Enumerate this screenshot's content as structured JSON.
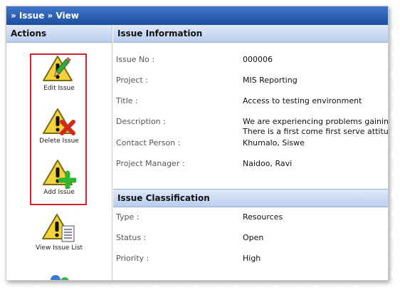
{
  "titlebar": {
    "text": "» Issue » View"
  },
  "actions_panel": {
    "header": "Actions",
    "items": [
      {
        "label": "Edit Issue",
        "icon": "edit-issue-icon"
      },
      {
        "label": "Delete Issue",
        "icon": "delete-issue-icon"
      },
      {
        "label": "Add Issue",
        "icon": "add-issue-icon"
      },
      {
        "label": "View Issue List",
        "icon": "view-issue-list-icon"
      },
      {
        "label": "",
        "icon": "users-icon"
      }
    ]
  },
  "issue_information": {
    "header": "Issue Information",
    "fields": [
      {
        "label": "Issue No :",
        "value": "000006"
      },
      {
        "label": "Project :",
        "value": "MIS Reporting"
      },
      {
        "label": "Title :",
        "value": "Access to testing environment"
      },
      {
        "label": "Description :",
        "value": "We are experiencing problems gaining ac",
        "value2": "There is a first come first serve attitude."
      },
      {
        "label": "Contact Person :",
        "value": "Khumalo, Siswe"
      },
      {
        "label": "Project Manager :",
        "value": "Naidoo, Ravi"
      }
    ]
  },
  "issue_classification": {
    "header": "Issue Classification",
    "fields": [
      {
        "label": "Type :",
        "value": "Resources"
      },
      {
        "label": "Status :",
        "value": "Open"
      },
      {
        "label": "Priority :",
        "value": "High"
      }
    ]
  },
  "colors": {
    "titlebar": "#1d4f9f",
    "panel_header": "#c9d9f2",
    "selection_border": "#d3232a",
    "warning_yellow": "#f2d33a"
  }
}
